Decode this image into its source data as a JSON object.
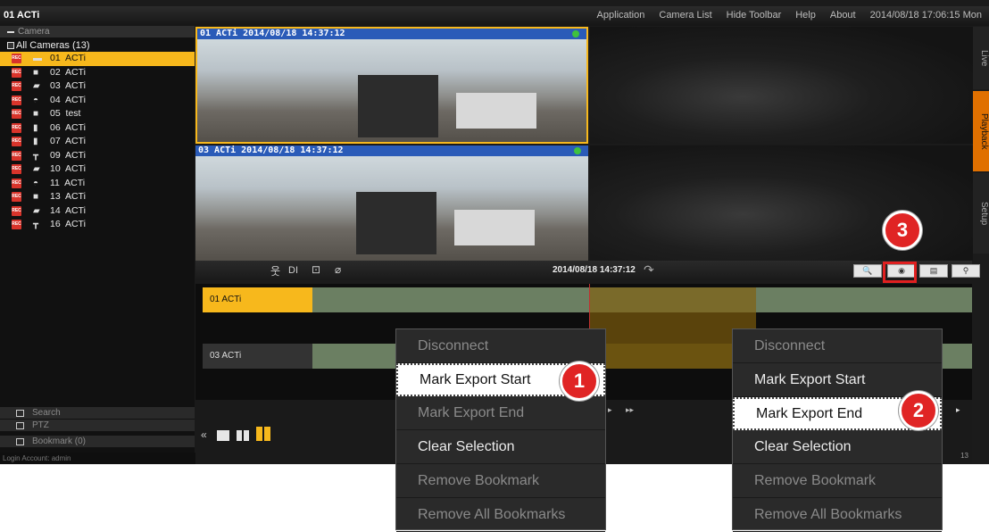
{
  "window": {
    "title": "01 ACTi"
  },
  "top_menu": [
    "Application",
    "Camera List",
    "Hide Toolbar",
    "Help",
    "About"
  ],
  "datetime": "2014/08/18 17:06:15 Mon",
  "sidebar": {
    "camera_header": "Camera",
    "root": "All Cameras (13)",
    "cameras": [
      {
        "id": "01",
        "name": "ACTi",
        "icon": "box-camera-icon"
      },
      {
        "id": "02",
        "name": "ACTi",
        "icon": "cube-camera-icon"
      },
      {
        "id": "03",
        "name": "ACTi",
        "icon": "bullet-camera-icon"
      },
      {
        "id": "04",
        "name": "ACTi",
        "icon": "dome-camera-icon"
      },
      {
        "id": "05",
        "name": "test",
        "icon": "cube-camera-icon"
      },
      {
        "id": "06",
        "name": "ACTi",
        "icon": "speed-dome-icon"
      },
      {
        "id": "07",
        "name": "ACTi",
        "icon": "speed-dome-icon"
      },
      {
        "id": "09",
        "name": "ACTi",
        "icon": "bullet-camera-icon"
      },
      {
        "id": "10",
        "name": "ACTi",
        "icon": "bullet-camera-icon"
      },
      {
        "id": "11",
        "name": "ACTi",
        "icon": "dome-camera-icon"
      },
      {
        "id": "13",
        "name": "ACTi",
        "icon": "cube-camera-icon"
      },
      {
        "id": "14",
        "name": "ACTi",
        "icon": "bullet-camera-icon"
      },
      {
        "id": "16",
        "name": "ACTi",
        "icon": "bullet-camera-icon"
      }
    ],
    "rec_badge": "REC",
    "footer": {
      "search": "Search",
      "ptz": "PTZ",
      "bookmark": "Bookmark (0)"
    },
    "login": "Login Account: admin"
  },
  "views": [
    {
      "caption": "01 ACTi  2014/08/18 14:37:12"
    },
    {
      "caption": "03 ACTi  2014/08/18 14:37:12"
    }
  ],
  "right_tabs": [
    "Live",
    "Playback",
    "Setup"
  ],
  "timeline": {
    "icons": [
      "motion-icon",
      "di-label",
      "alert-icon",
      "link-icon"
    ],
    "di_label": "DI",
    "time": "2014/08/18 14:37:12",
    "tracks": [
      "01 ACTi",
      "03 ACTi"
    ]
  },
  "status_count": "13",
  "context_menu": {
    "items": [
      "Disconnect",
      "Mark Export Start",
      "Mark Export End",
      "Clear Selection",
      "Remove Bookmark",
      "Remove All Bookmarks"
    ]
  },
  "badges": [
    "1",
    "2",
    "3"
  ],
  "colors": {
    "accent": "#f7b81c",
    "rec": "#d9342b",
    "caption": "#2a5bb8",
    "track": "#6b7f62",
    "selection": "#6b5310",
    "badge": "#e02424"
  }
}
